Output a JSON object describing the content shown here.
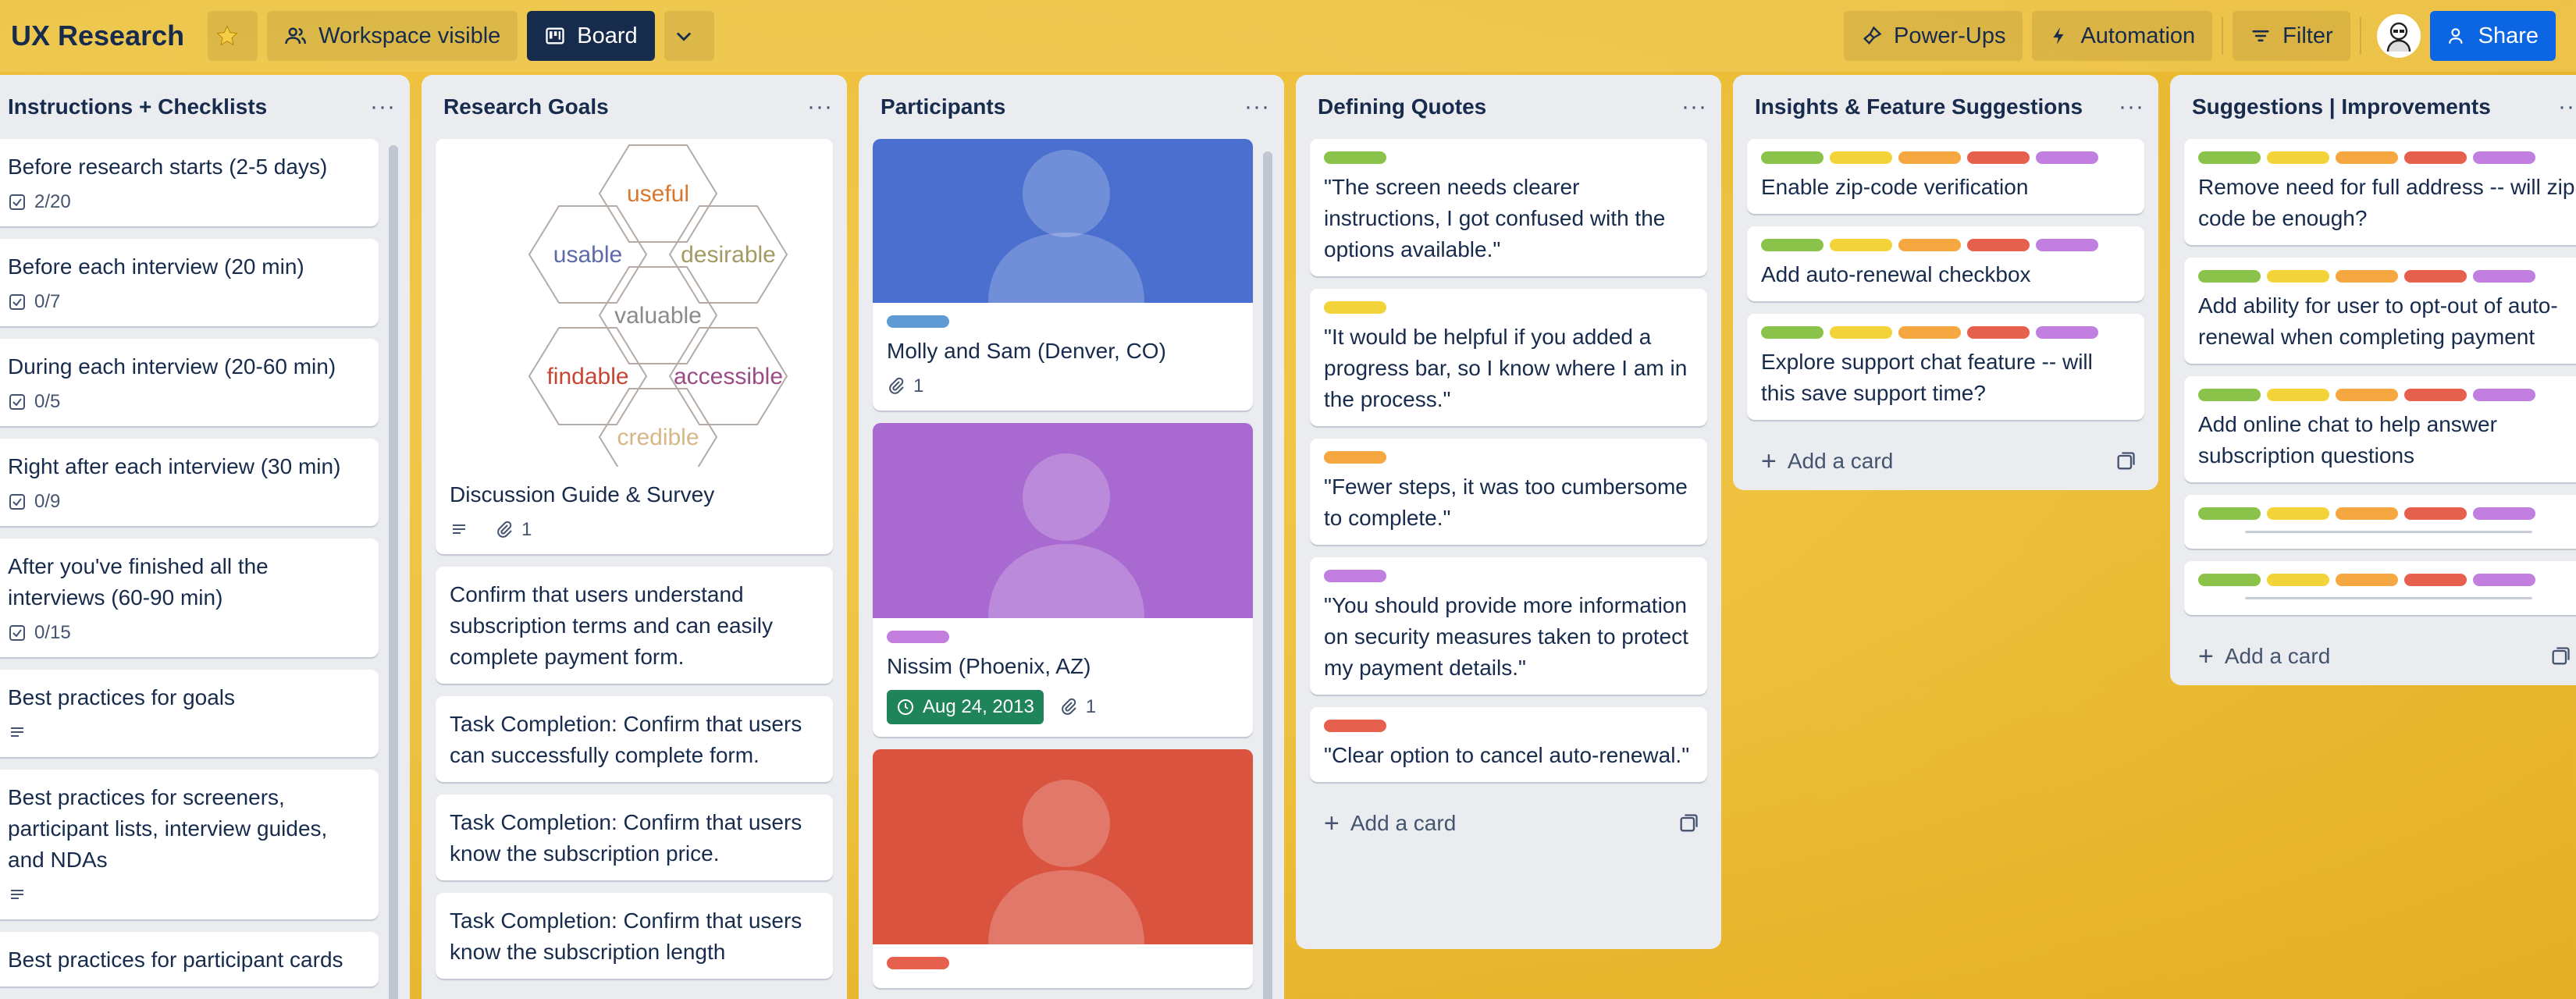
{
  "header": {
    "title": "UX Research",
    "visibility_label": "Workspace visible",
    "view_label": "Board",
    "powerups_label": "Power-Ups",
    "automation_label": "Automation",
    "filter_label": "Filter",
    "share_label": "Share"
  },
  "colors": {
    "green": "#8bc34a",
    "yellow": "#f2d43a",
    "orange": "#f5a742",
    "red": "#e5614e",
    "purple": "#c27fe0",
    "blue": "#5e9bd4",
    "accent": "#0c66e4"
  },
  "lists": {
    "instructions": {
      "title": "Instructions + Checklists",
      "cards": [
        {
          "title": "Before research starts (2-5 days)",
          "checklist": "2/20"
        },
        {
          "title": "Before each interview (20 min)",
          "checklist": "0/7"
        },
        {
          "title": "During each interview (20-60 min)",
          "checklist": "0/5"
        },
        {
          "title": "Right after each interview (30 min)",
          "checklist": "0/9"
        },
        {
          "title": "After you've finished all the interviews (60-90 min)",
          "checklist": "0/15"
        },
        {
          "title": "Best practices for goals"
        },
        {
          "title": "Best practices for screeners, participant lists, interview guides, and NDAs"
        },
        {
          "title": "Best practices for participant cards"
        }
      ]
    },
    "goals": {
      "title": "Research Goals",
      "honeycomb": [
        "useful",
        "usable",
        "desirable",
        "valuable",
        "findable",
        "accessible",
        "credible"
      ],
      "cards": [
        {
          "title": "Discussion Guide & Survey",
          "attachments": "1"
        },
        {
          "title": "Confirm that users understand subscription terms and can easily complete payment form."
        },
        {
          "title": "Task Completion: Confirm that users can successfully complete form."
        },
        {
          "title": "Task Completion: Confirm that users know the subscription price."
        },
        {
          "title": "Task Completion: Confirm that users know the subscription length"
        }
      ]
    },
    "participants": {
      "title": "Participants",
      "cards": [
        {
          "title": "Molly and Sam (Denver, CO)",
          "attachments": "1",
          "cover": "#4a6fcf"
        },
        {
          "title": "Nissim (Phoenix, AZ)",
          "date": "Aug 24, 2013",
          "attachments": "1",
          "cover": "#a86ad1"
        },
        {
          "title": "",
          "cover": "#d9533f"
        }
      ]
    },
    "quotes": {
      "title": "Defining Quotes",
      "cards": [
        {
          "title": "\"The screen needs clearer instructions, I got confused with the options available.\""
        },
        {
          "title": "\"It would be helpful if you added a progress bar, so I know where I am in the process.\""
        },
        {
          "title": "\"Fewer steps, it was too cumbersome to complete.\""
        },
        {
          "title": "\"You should provide more information on security measures taken to protect my payment details.\""
        },
        {
          "title": "\"Clear option to cancel auto-renewal.\""
        }
      ],
      "add_label": "Add a card"
    },
    "insights": {
      "title": "Insights & Feature Suggestions",
      "cards": [
        {
          "title": "Enable zip-code verification"
        },
        {
          "title": "Add auto-renewal checkbox"
        },
        {
          "title": "Explore support chat feature -- will this save support time?"
        }
      ],
      "add_label": "Add a card"
    },
    "suggestions": {
      "title": "Suggestions | Improvements",
      "cards": [
        {
          "title": "Remove need for full address -- will zip code be enough?"
        },
        {
          "title": "Add ability for user to opt-out of auto-renewal when completing payment"
        },
        {
          "title": "Add online chat to help answer subscription questions"
        }
      ],
      "add_label": "Add a card"
    }
  }
}
